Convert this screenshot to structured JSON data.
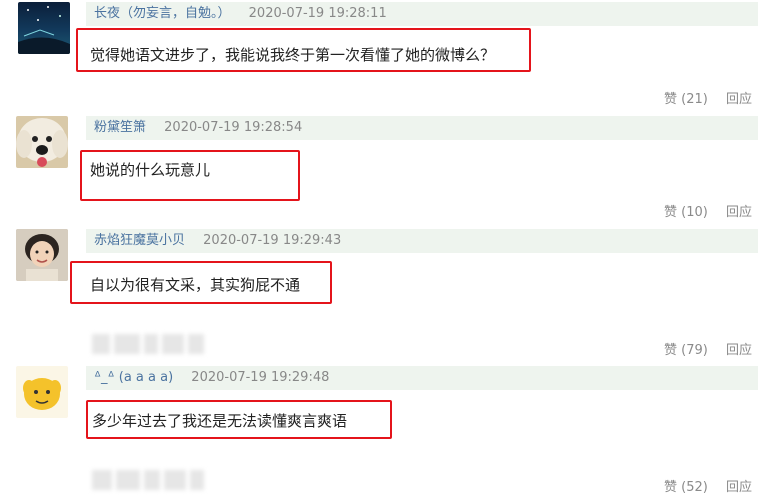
{
  "comments": [
    {
      "username": "长夜（勿妄言，自勉。）",
      "time": "2020-07-19 19:28:11",
      "text": "觉得她语文进步了，我能说我终于第一次看懂了她的微博么？",
      "like_label": "赞 (21)",
      "reply_label": "回应",
      "avatar_icon": "night-sky-avatar"
    },
    {
      "username": "粉黛笙箫",
      "time": "2020-07-19 19:28:54",
      "text": "她说的什么玩意儿",
      "like_label": "赞 (10)",
      "reply_label": "回应",
      "avatar_icon": "white-dog-avatar"
    },
    {
      "username": "赤焰狂魔莫小贝",
      "time": "2020-07-19 19:29:43",
      "text": "自以为很有文采，其实狗屁不通",
      "like_label": "赞 (79)",
      "reply_label": "回应",
      "avatar_icon": "girl-photo-avatar"
    },
    {
      "username": "ᐞ_ᐞ (a a a a)",
      "time": "2020-07-19 19:29:48",
      "text": "多少年过去了我还是无法读懂爽言爽语",
      "like_label": "赞 (52)",
      "reply_label": "回应",
      "avatar_icon": "cartoon-emoji-avatar"
    }
  ],
  "colors": {
    "highlight": "#e4141b",
    "username": "#4b73a0",
    "header_bg": "#eef4ee"
  }
}
